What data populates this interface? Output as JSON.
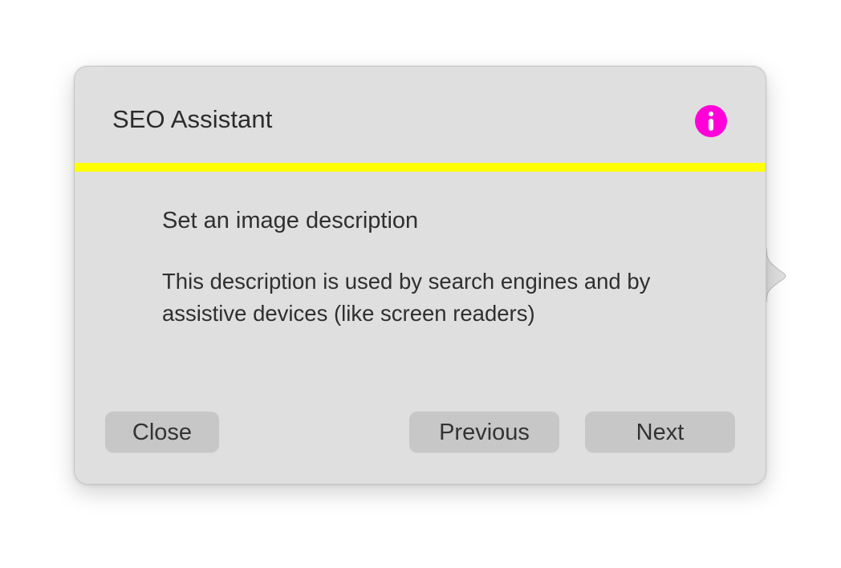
{
  "colors": {
    "accent_bar": "#ffff00",
    "info_icon": "#ff00d8",
    "panel_background": "#e0dfdf",
    "button_background": "#c8c7c7"
  },
  "popover": {
    "title": "SEO Assistant",
    "info_icon": "info-icon",
    "step": {
      "title": "Set an image description",
      "description": "This description is used by search engines and by assistive devices (like screen readers)"
    },
    "buttons": {
      "close_label": "Close",
      "previous_label": "Previous",
      "next_label": "Next"
    }
  }
}
